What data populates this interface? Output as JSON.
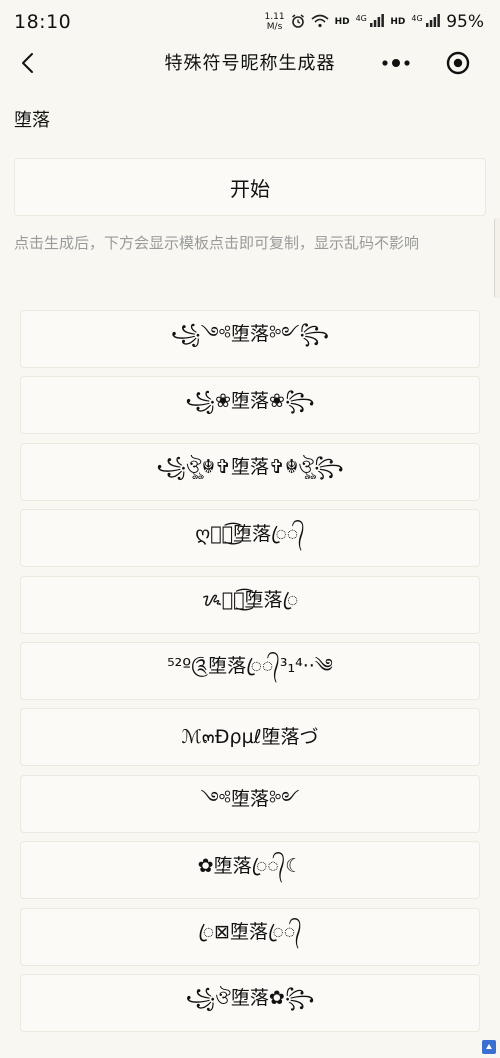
{
  "status_bar": {
    "time": "18:10",
    "net_speed_value": "1.11",
    "net_speed_unit": "M/s",
    "hd_label_1": "HD",
    "hd_label_2": "HD",
    "net_label_1": "4G",
    "net_label_2": "4G",
    "battery": "95%"
  },
  "nav": {
    "title": "特殊符号昵称生成器"
  },
  "form": {
    "input_value": "堕落",
    "start_label": "开始",
    "hint": "点击生成后，下方会显示模板点击即可复制，显示乱码不影响"
  },
  "results": [
    "꧁༺堕落༻꧂",
    "꧁❀堕落❀꧂",
    "꧁ঔৣ☬✞堕落✞☬ঔৣ꧂",
    "ღ༊ོ͜͡堕落ꦿ᭄",
    "ᝰ༊ོ͜͡堕落ꦿ",
    "⁵²º༊堕落ꦿ᭄³₁⁴··༄",
    "ℳ๓Ðρµℓ堕落づ",
    "༺堕落༻",
    "✿堕落ꦿ᭄☾",
    "ꦿ⊠堕落ꦿ᭄",
    "꧁ঔ堕落✿꧂"
  ]
}
